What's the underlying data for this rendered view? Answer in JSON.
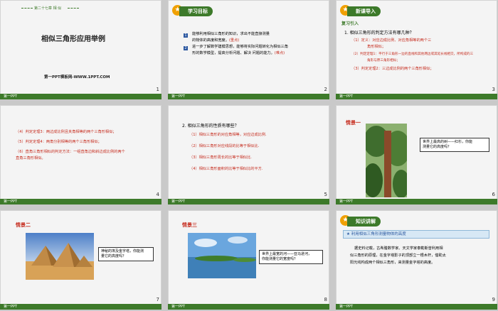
{
  "footer_brand": "第一PPT",
  "slides": [
    {
      "top_label": "第二十七章 相 似",
      "title": "相似三角形应用举例",
      "subtitle": "第一PPT模板网-WWW.1PPT.COM",
      "num": "1"
    },
    {
      "heading": "学习目标",
      "items": [
        {
          "n": "1",
          "text": "能够利用相似三角形的知识，求出不能直接测量",
          "text2": "的物体的高度和宽度。",
          "hl": "(重点)"
        },
        {
          "n": "2",
          "text": "进一步了解数学建模思想，能够将实际问题转化为相似三角",
          "text2": "形的数学模型，提高分析问题、解决  问题的能力。",
          "hl": "(难点)"
        }
      ],
      "num": "2"
    },
    {
      "heading": "新课导入",
      "sub": "复习引入",
      "q": "1. 相似三角形的判定方法有哪几种？",
      "items": [
        {
          "a": "（1）定义：对应边成比例、对应角相等的两个三",
          "b": "角形相似；"
        },
        {
          "a": "（2）判定定理1：平行于三角形一边的直线和其他两边或其延长线相交，所构成的三",
          "b": "角形与原三角形相似；"
        },
        {
          "a": "（3）判定定理2：三边成比例的两个三角形相似；",
          "b": ""
        }
      ],
      "num": "3"
    },
    {
      "items": [
        {
          "a": "（4）判定定理3：两边成比例且夹角相等的两个三角形相似；",
          "b": ""
        },
        {
          "a": "（5）判定定理4：两角分别相等的两个三角形相似；",
          "b": ""
        },
        {
          "a": "（6）直角三角形相似的判定方法：一组直角边和斜边成比例的两个",
          "b": "直角三角形相似。"
        }
      ],
      "num": "4"
    },
    {
      "q": "2. 相似三角形的性质有哪些？",
      "items": [
        "（1）相似三角形的对应角相等，对应边成比例.",
        "（2）相似三角形对应线段的比等于相似比.",
        "（3）相似三角形周长的比等于相似比.",
        "（4）相似三角形面积的比等于相似比的平方."
      ],
      "num": "5"
    },
    {
      "label": "情景一",
      "bubble": "世界上最高的树——红杉，你能测量它的高度吗？",
      "bubble1": "世界上最高的树——红杉，你能",
      "bubble2": "测量它的高度吗？",
      "num": "6"
    },
    {
      "label": "情景二",
      "bubble1": "神秘的埃及金字塔，你能测",
      "bubble2": "量它的高度吗？",
      "num": "7"
    },
    {
      "label": "情景三",
      "bubble1": "世界上最宽的河——亚马逊河，",
      "bubble2": "你能测量它的宽度吗？",
      "num": "8"
    },
    {
      "heading": "知识讲解",
      "banner": "利用相似三角形测量物体的高度",
      "lines": [
        "据史料记载，古希腊数学家、天文学家泰勒斯曾利用相",
        "似三角形的原理，在金字塔影子的顶部立一根木杆，借助太",
        "阳光线构成两个相似三角形，来测量金字塔的高度。"
      ],
      "num": "9"
    }
  ],
  "colors": {
    "green": "#3d7a2a",
    "accent": "#f0a000",
    "red": "#c62d1f",
    "bg": "#c9c9c9"
  }
}
